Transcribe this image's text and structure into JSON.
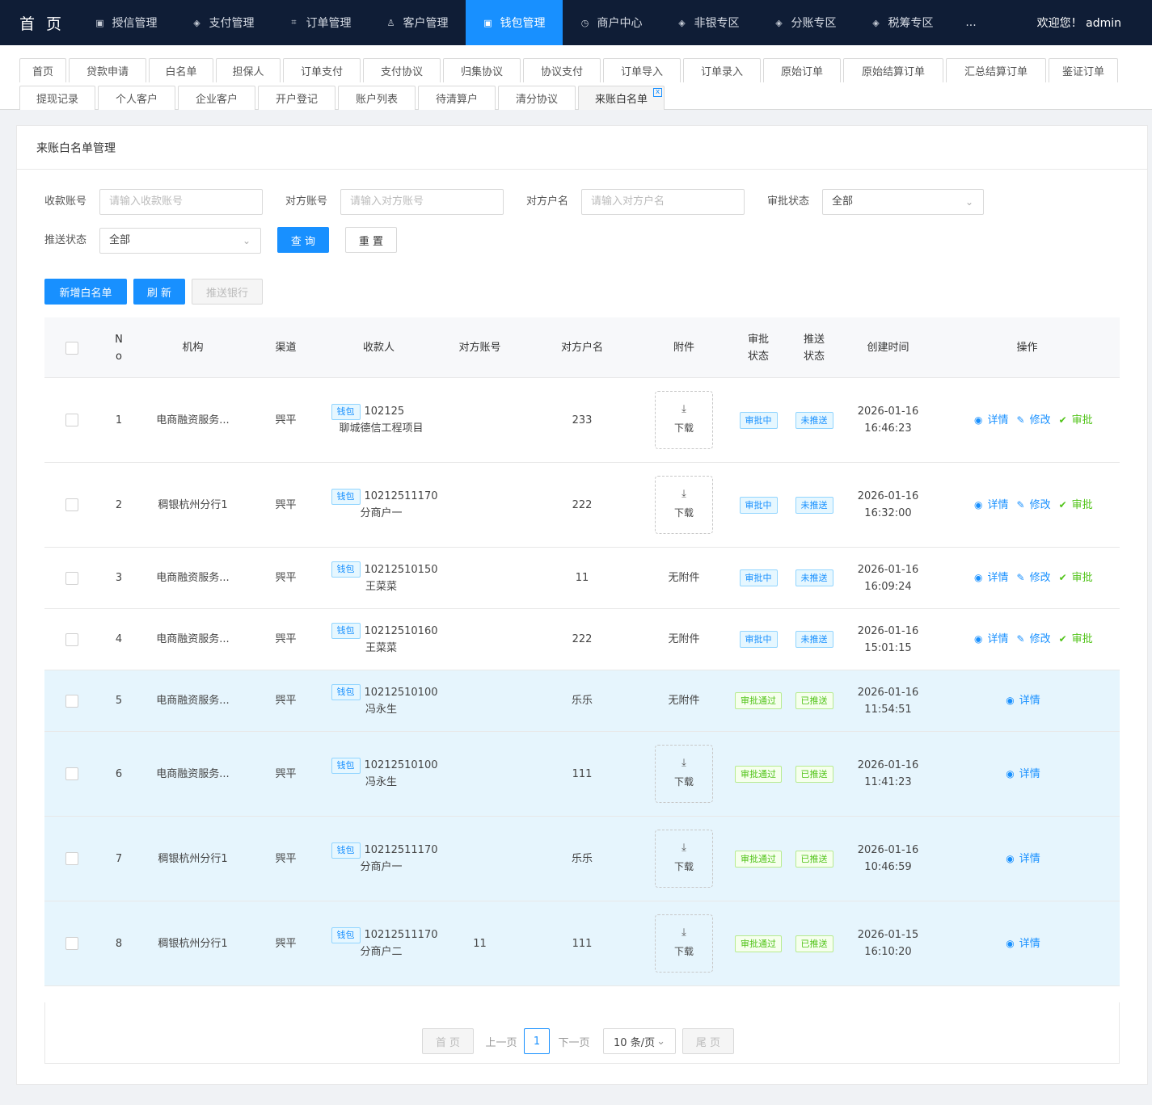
{
  "topnav": {
    "brand": "首 页",
    "items": [
      {
        "label": "授信管理",
        "icon": "square-icon"
      },
      {
        "label": "支付管理",
        "icon": "shield-icon"
      },
      {
        "label": "订单管理",
        "icon": "cart-icon"
      },
      {
        "label": "客户管理",
        "icon": "user-icon"
      },
      {
        "label": "钱包管理",
        "icon": "square-icon",
        "active": true
      },
      {
        "label": "商户中心",
        "icon": "clock-icon"
      },
      {
        "label": "非银专区",
        "icon": "shield-icon"
      },
      {
        "label": "分账专区",
        "icon": "shield-icon"
      },
      {
        "label": "税筹专区",
        "icon": "shield-icon"
      }
    ],
    "more": "...",
    "welcome": "欢迎您！ admin"
  },
  "tabs": {
    "row1": [
      "首页",
      "贷款申请",
      "白名单",
      "担保人",
      "订单支付",
      "支付协议",
      "归集协议",
      "协议支付",
      "订单导入",
      "订单录入",
      "原始订单",
      "原始结算订单",
      "汇总结算订单",
      "鉴证订单"
    ],
    "row2": [
      "提现记录",
      "个人客户",
      "企业客户",
      "开户登记",
      "账户列表",
      "待清算户",
      "清分协议",
      "来账白名单"
    ],
    "active": "来账白名单",
    "close_symbol": "x"
  },
  "page": {
    "title": "来账白名单管理"
  },
  "filters": {
    "account_label": "收款账号",
    "account_placeholder": "请输入收款账号",
    "counter_account_label": "对方账号",
    "counter_account_placeholder": "请输入对方账号",
    "counter_name_label": "对方户名",
    "counter_name_placeholder": "请输入对方户名",
    "approval_label": "审批状态",
    "approval_value": "全部",
    "push_label": "推送状态",
    "push_value": "全部",
    "query_button": "查 询",
    "reset_button": "重 置"
  },
  "toolbar": {
    "add_button": "新增白名单",
    "refresh_button": "刷 新",
    "push_bank_button": "推送银行"
  },
  "table": {
    "headers": {
      "no": "N\no",
      "org": "机构",
      "channel": "渠道",
      "payee": "收款人",
      "counter_account": "对方账号",
      "counter_name": "对方户名",
      "attachment": "附件",
      "approval": "审批\n状态",
      "push": "推送\n状态",
      "created": "创建时间",
      "ops": "操作"
    },
    "download_label": "下载",
    "no_attachment_label": "无附件",
    "ops_labels": {
      "detail": "详情",
      "edit": "修改",
      "approve": "审批"
    },
    "rows": [
      {
        "no": "1",
        "org": "电商融资服务...",
        "channel": "巺平",
        "payee_tag": "钱包",
        "payee_account": "102125",
        "payee_name": "聊城德信工程项目",
        "counter_account": "",
        "counter_name": "233",
        "attachment": "download",
        "approval": "审批中",
        "push": "未推送",
        "date": "2026-01-16",
        "time": "16:46:23",
        "ops": [
          "detail",
          "edit",
          "approve"
        ],
        "highlight": false
      },
      {
        "no": "2",
        "org": "稠银杭州分行1",
        "channel": "巺平",
        "payee_tag": "钱包",
        "payee_account": "10212511170",
        "payee_name": "分商户一",
        "counter_account": "",
        "counter_name": "222",
        "attachment": "download",
        "approval": "审批中",
        "push": "未推送",
        "date": "2026-01-16",
        "time": "16:32:00",
        "ops": [
          "detail",
          "edit",
          "approve"
        ],
        "highlight": false
      },
      {
        "no": "3",
        "org": "电商融资服务...",
        "channel": "巺平",
        "payee_tag": "钱包",
        "payee_account": "10212510150",
        "payee_name": "王菜菜",
        "counter_account": "",
        "counter_name": "11",
        "attachment": "none",
        "approval": "审批中",
        "push": "未推送",
        "date": "2026-01-16",
        "time": "16:09:24",
        "ops": [
          "detail",
          "edit",
          "approve"
        ],
        "highlight": false
      },
      {
        "no": "4",
        "org": "电商融资服务...",
        "channel": "巺平",
        "payee_tag": "钱包",
        "payee_account": "10212510160",
        "payee_name": "王菜菜",
        "counter_account": "",
        "counter_name": "222",
        "attachment": "none",
        "approval": "审批中",
        "push": "未推送",
        "date": "2026-01-16",
        "time": "15:01:15",
        "ops": [
          "detail",
          "edit",
          "approve"
        ],
        "highlight": false
      },
      {
        "no": "5",
        "org": "电商融资服务...",
        "channel": "巺平",
        "payee_tag": "钱包",
        "payee_account": "10212510100",
        "payee_name": "冯永生",
        "counter_account": "",
        "counter_name": "乐乐",
        "attachment": "none",
        "approval": "审批通过",
        "push": "已推送",
        "date": "2026-01-16",
        "time": "11:54:51",
        "ops": [
          "detail"
        ],
        "highlight": true
      },
      {
        "no": "6",
        "org": "电商融资服务...",
        "channel": "巺平",
        "payee_tag": "钱包",
        "payee_account": "10212510100",
        "payee_name": "冯永生",
        "counter_account": "",
        "counter_name": "111",
        "attachment": "download",
        "approval": "审批通过",
        "push": "已推送",
        "date": "2026-01-16",
        "time": "11:41:23",
        "ops": [
          "detail"
        ],
        "highlight": true
      },
      {
        "no": "7",
        "org": "稠银杭州分行1",
        "channel": "巺平",
        "payee_tag": "钱包",
        "payee_account": "10212511170",
        "payee_name": "分商户一",
        "counter_account": "",
        "counter_name": "乐乐",
        "attachment": "download",
        "approval": "审批通过",
        "push": "已推送",
        "date": "2026-01-16",
        "time": "10:46:59",
        "ops": [
          "detail"
        ],
        "highlight": true
      },
      {
        "no": "8",
        "org": "稠银杭州分行1",
        "channel": "巺平",
        "payee_tag": "钱包",
        "payee_account": "10212511170",
        "payee_name": "分商户二",
        "counter_account": "11",
        "counter_name": "111",
        "attachment": "download",
        "approval": "审批通过",
        "push": "已推送",
        "date": "2026-01-15",
        "time": "16:10:20",
        "ops": [
          "detail"
        ],
        "highlight": true
      }
    ]
  },
  "pagination": {
    "first": "首 页",
    "prev": "上一页",
    "current": "1",
    "next": "下一页",
    "page_size": "10 条/页",
    "last": "尾 页"
  },
  "colors": {
    "nav_bg": "#0f1d36",
    "accent": "#1890ff",
    "success": "#52c41a",
    "row_highlight": "#e6f5fd"
  }
}
